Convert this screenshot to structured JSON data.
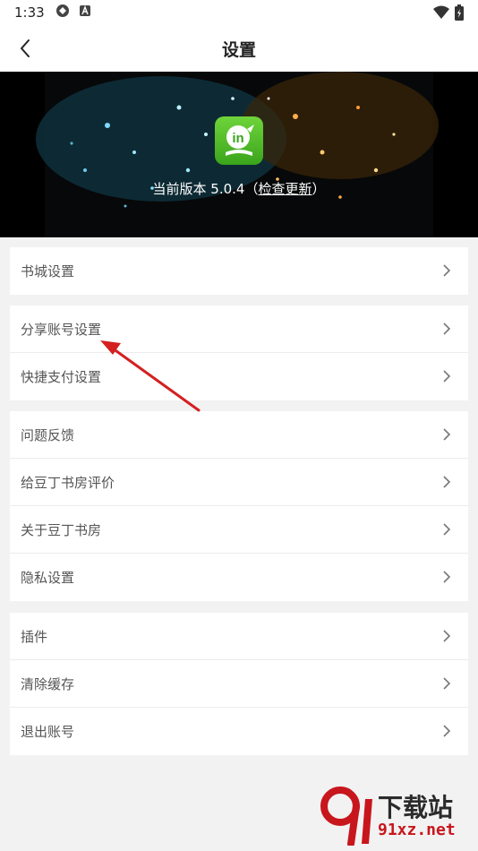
{
  "status_bar": {
    "time": "1:33"
  },
  "header": {
    "title": "设置"
  },
  "banner": {
    "version_text": "当前版本 5.0.4（",
    "check_update": "检查更新",
    "close_paren": "）"
  },
  "groups": [
    {
      "items": [
        {
          "label": "书城设置"
        }
      ]
    },
    {
      "items": [
        {
          "label": "分享账号设置"
        },
        {
          "label": "快捷支付设置"
        }
      ]
    },
    {
      "items": [
        {
          "label": "问题反馈"
        },
        {
          "label": "给豆丁书房评价"
        },
        {
          "label": "关于豆丁书房"
        },
        {
          "label": "隐私设置"
        }
      ]
    },
    {
      "items": [
        {
          "label": "插件"
        },
        {
          "label": "清除缓存"
        },
        {
          "label": "退出账号"
        }
      ]
    }
  ],
  "watermark": {
    "title": "下载站",
    "url": "91xz.net"
  },
  "colors": {
    "accent_arrow": "#d42020",
    "logo_green": "#4cba24"
  }
}
